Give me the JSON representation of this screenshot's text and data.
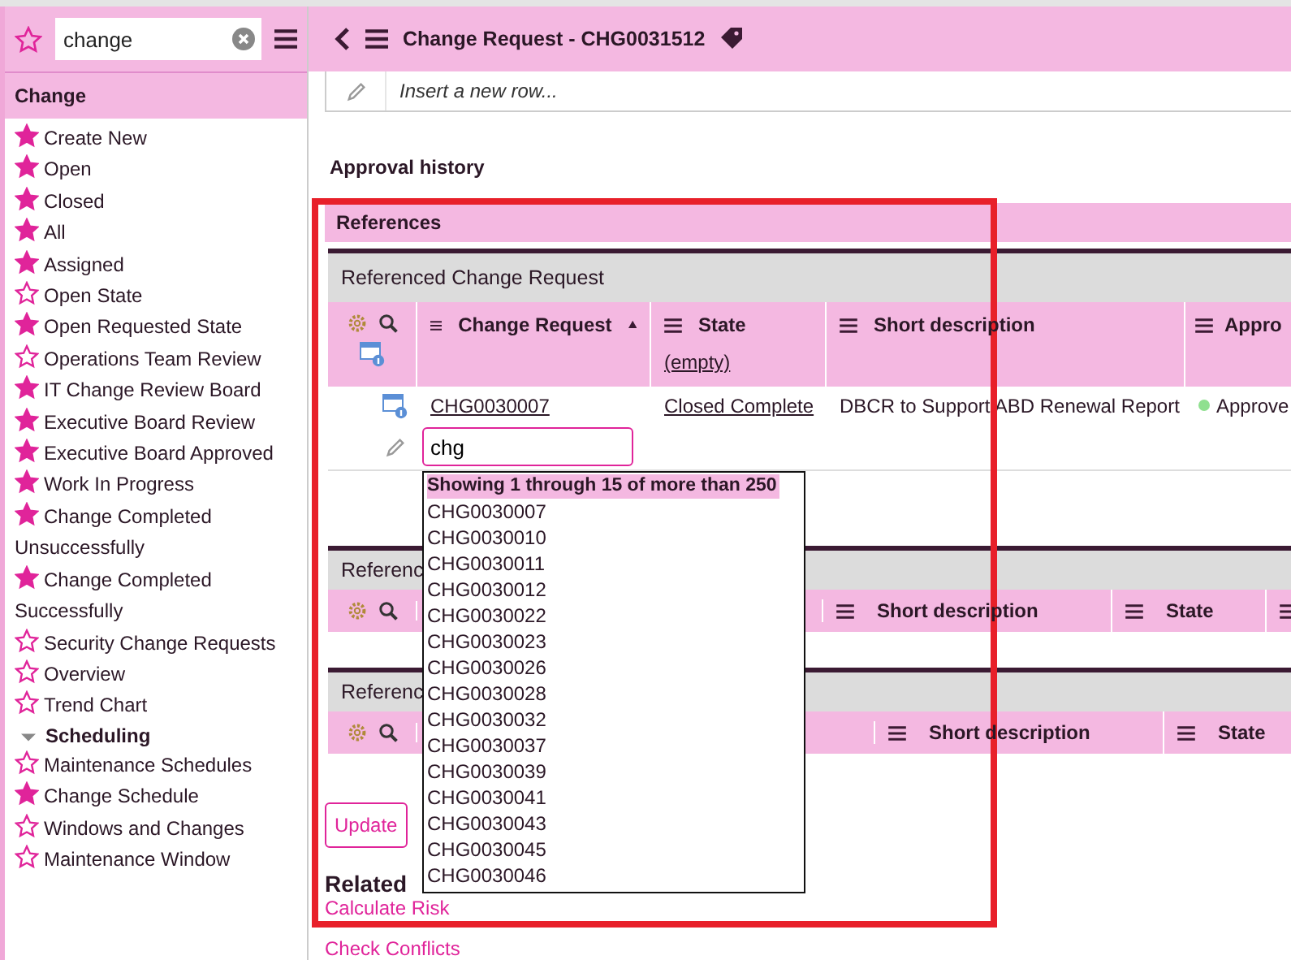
{
  "sidebar": {
    "search": {
      "value": "change"
    },
    "section_title": "Change",
    "items": [
      {
        "label": "Create New",
        "favorite": true
      },
      {
        "label": "Open",
        "favorite": true
      },
      {
        "label": "Closed",
        "favorite": true
      },
      {
        "label": "All",
        "favorite": true
      },
      {
        "label": "Assigned",
        "favorite": true
      },
      {
        "label": "Open State",
        "favorite": false
      },
      {
        "label": "Open Requested State",
        "favorite": true
      },
      {
        "label": "Operations Team Review",
        "favorite": false
      },
      {
        "label": "IT Change Review Board",
        "favorite": true
      },
      {
        "label": "Executive Board Review",
        "favorite": true
      },
      {
        "label": "Executive Board Approved",
        "favorite": true
      },
      {
        "label": "Work In Progress",
        "favorite": true
      },
      {
        "label": "Change Completed Unsuccessfully",
        "favorite": true
      },
      {
        "label": "Change Completed Successfully",
        "favorite": true
      },
      {
        "label": "Security Change Requests",
        "favorite": false
      },
      {
        "label": "Overview",
        "favorite": false
      },
      {
        "label": "Trend Chart",
        "favorite": false
      }
    ],
    "groups": [
      {
        "label": "Scheduling",
        "expanded": true,
        "children": [
          {
            "label": "Maintenance Schedules",
            "favorite": false
          },
          {
            "label": "Change Schedule",
            "favorite": true
          },
          {
            "label": "Windows and Changes",
            "favorite": false
          },
          {
            "label": "Maintenance Window",
            "favorite": false
          }
        ]
      }
    ]
  },
  "header": {
    "title": "Change Request - CHG0031512"
  },
  "insert_row": {
    "placeholder": "Insert a new row..."
  },
  "approval_history": {
    "title": "Approval history"
  },
  "references": {
    "title": "References",
    "main_table": {
      "title": "Referenced Change Request",
      "columns": [
        {
          "label": "Change Request",
          "sorted_ascending": true
        },
        {
          "label": "State",
          "filter": "(empty)"
        },
        {
          "label": "Short description"
        },
        {
          "label": "Appro"
        }
      ],
      "rows": [
        {
          "cells": [
            "CHG0030007",
            "Closed Complete",
            "DBCR to Support ABD Renewal Report",
            "Approve"
          ],
          "color": "#8fe08f"
        }
      ],
      "edit_row": {
        "value": "chg"
      }
    },
    "lookup": {
      "summary": "Showing 1 through 15 of more than 250",
      "options": [
        "CHG0030007",
        "CHG0030010",
        "CHG0030011",
        "CHG0030012",
        "CHG0030022",
        "CHG0030023",
        "CHG0030026",
        "CHG0030028",
        "CHG0030032",
        "CHG0030037",
        "CHG0030039",
        "CHG0030041",
        "CHG0030043",
        "CHG0030045",
        "CHG0030046"
      ]
    },
    "other_tables": [
      {
        "title": "Referenc",
        "columns": [
          "Short description",
          "State"
        ]
      },
      {
        "title": "Referenc",
        "columns": [
          "Short description",
          "State"
        ]
      }
    ]
  },
  "update_button": "Update",
  "related": {
    "title": "Related",
    "links": [
      "Calculate Risk",
      "Check Conflicts"
    ]
  }
}
